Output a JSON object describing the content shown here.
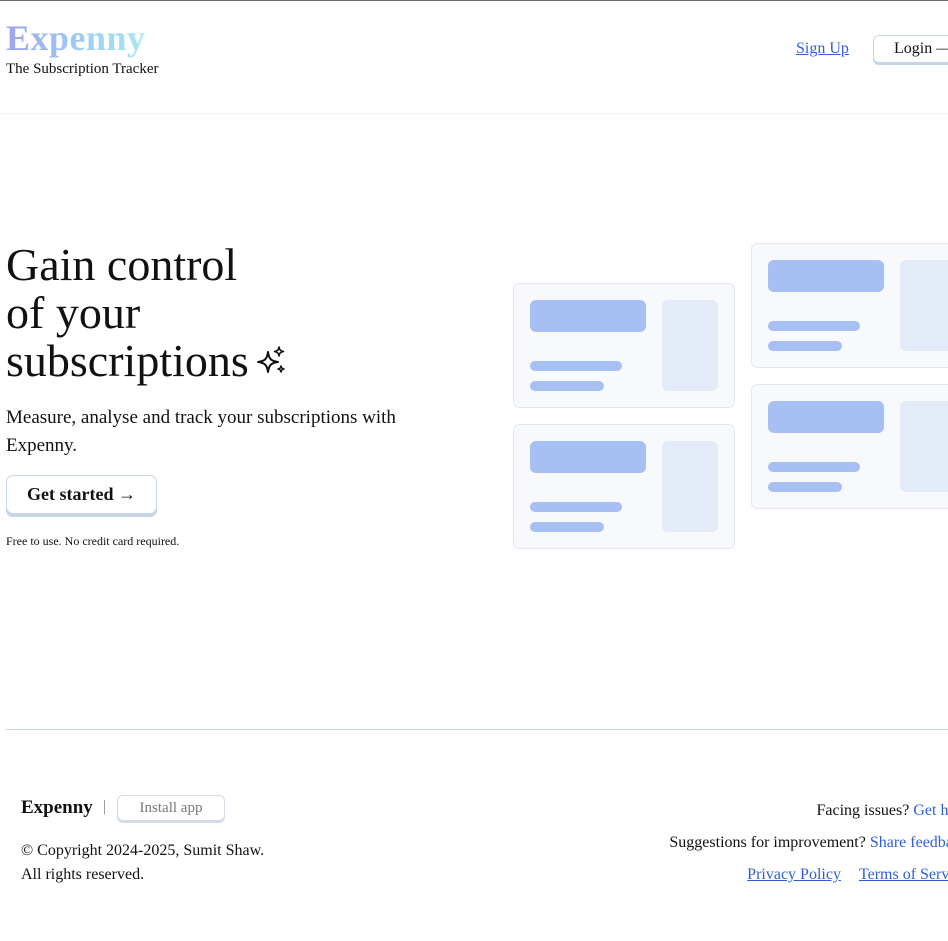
{
  "header": {
    "brand_name": "Expenny",
    "tagline": "The Subscription Tracker",
    "signup_label": "Sign Up",
    "login_label": "Login —"
  },
  "hero": {
    "title_line1": "Gain control",
    "title_line2": "of your",
    "title_line3": "subscriptions",
    "subtitle": "Measure, analyse and track your subscriptions with Expenny.",
    "cta_label": "Get started →",
    "note": "Free to use. No credit card required.",
    "icon": "sparkles-icon"
  },
  "colors": {
    "brand_gradient_start": "#9ea3f0",
    "brand_gradient_end": "#a6edf0",
    "link": "#2f5fd8",
    "card_accent": "#a8bff4",
    "card_side": "#e3eaf8",
    "card_bg": "#f7f9fc"
  },
  "footer": {
    "brand_name": "Expenny",
    "separator": "|",
    "install_label": "Install app",
    "copyright_line1": "© Copyright 2024-2025, Sumit Shaw.",
    "copyright_line2": "All rights reserved.",
    "issues_text": "Facing issues?",
    "issues_link": "Get help",
    "suggestions_text": "Suggestions for improvement?",
    "suggestions_link": "Share feedback",
    "privacy_label": "Privacy Policy",
    "terms_label": "Terms of Service"
  }
}
